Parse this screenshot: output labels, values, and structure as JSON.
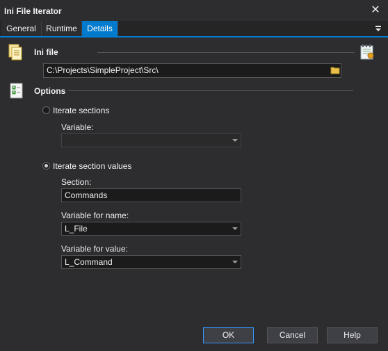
{
  "window": {
    "title": "Ini File Iterator",
    "close_glyph": "✕"
  },
  "tabs": [
    {
      "label": "General",
      "active": false
    },
    {
      "label": "Runtime",
      "active": false
    },
    {
      "label": "Details",
      "active": true
    }
  ],
  "ini_file": {
    "label": "Ini file",
    "value": "C:\\Projects\\SimpleProject\\Src\\"
  },
  "options": {
    "label": "Options",
    "iterate_sections": {
      "label": "Iterate sections",
      "selected": false,
      "variable_label": "Variable:",
      "variable_value": ""
    },
    "iterate_section_values": {
      "label": "Iterate section values",
      "selected": true,
      "section_label": "Section:",
      "section_value": "Commands",
      "var_name_label": "Variable for name:",
      "var_name_value": "L_File",
      "var_value_label": "Variable for value:",
      "var_value_value": "L_Command"
    }
  },
  "buttons": {
    "ok": "OK",
    "cancel": "Cancel",
    "help": "Help"
  },
  "colors": {
    "accent": "#007acc",
    "background": "#2d2d30",
    "input_bg": "#1b1b1c"
  }
}
